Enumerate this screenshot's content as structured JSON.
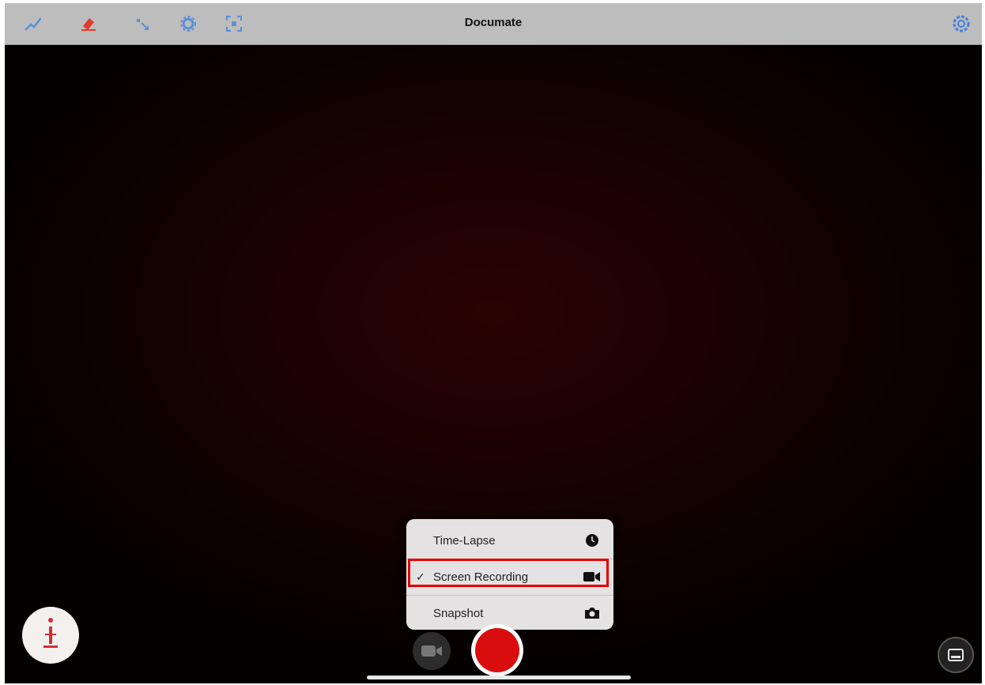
{
  "toolbar": {
    "title": "Documate",
    "tools": [
      {
        "icon": "pen-icon",
        "color": "#5b8fd9"
      },
      {
        "icon": "eraser-icon",
        "color": "#e23a2c"
      },
      {
        "icon": "pointer-icon",
        "color": "#5b8fd9"
      },
      {
        "icon": "settings-cog-icon",
        "color": "#5b8fd9"
      },
      {
        "icon": "focus-frame-icon",
        "color": "#5b8fd9"
      }
    ],
    "right_icon": {
      "icon": "settings-gear-icon",
      "color": "#3d7fe0"
    }
  },
  "capture_menu": {
    "items": [
      {
        "label": "Time-Lapse",
        "icon": "clock-icon",
        "checked": false,
        "check_mark": ""
      },
      {
        "label": "Screen Recording",
        "icon": "video-camera-icon",
        "checked": true,
        "check_mark": "✓"
      },
      {
        "label": "Snapshot",
        "icon": "camera-icon",
        "checked": false,
        "check_mark": ""
      }
    ],
    "highlight_color": "#e00000"
  },
  "controls": {
    "shutter_color": "#d90d0d",
    "record_mode": "Screen Recording"
  }
}
